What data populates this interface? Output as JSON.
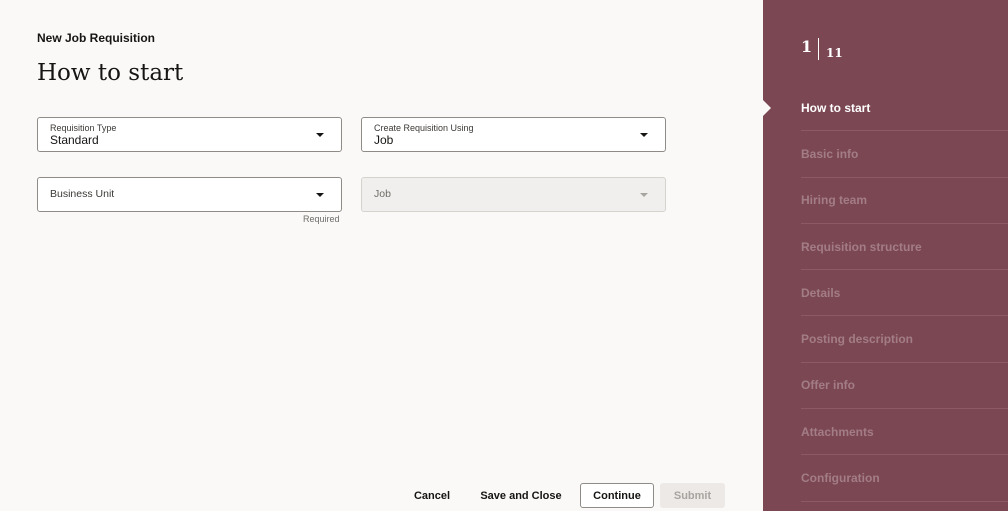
{
  "header": {
    "breadcrumb": "New Job Requisition",
    "title": "How to start"
  },
  "form": {
    "requisition_type": {
      "label": "Requisition Type",
      "value": "Standard"
    },
    "create_using": {
      "label": "Create Requisition Using",
      "value": "Job"
    },
    "business_unit": {
      "label": "Business Unit",
      "required_text": "Required"
    },
    "job": {
      "label": "Job"
    }
  },
  "footer": {
    "cancel": "Cancel",
    "save_close": "Save and Close",
    "continue": "Continue",
    "submit": "Submit"
  },
  "progress": {
    "current": "1",
    "total": "11",
    "steps": [
      {
        "label": "How to start",
        "active": true
      },
      {
        "label": "Basic info"
      },
      {
        "label": "Hiring team"
      },
      {
        "label": "Requisition structure"
      },
      {
        "label": "Details"
      },
      {
        "label": "Posting description"
      },
      {
        "label": "Offer info"
      },
      {
        "label": "Attachments"
      },
      {
        "label": "Configuration"
      }
    ]
  },
  "colors": {
    "sidebar_bg": "#7b4753",
    "page_bg": "#fbf9f8",
    "inactive_step": "#a37d86"
  }
}
